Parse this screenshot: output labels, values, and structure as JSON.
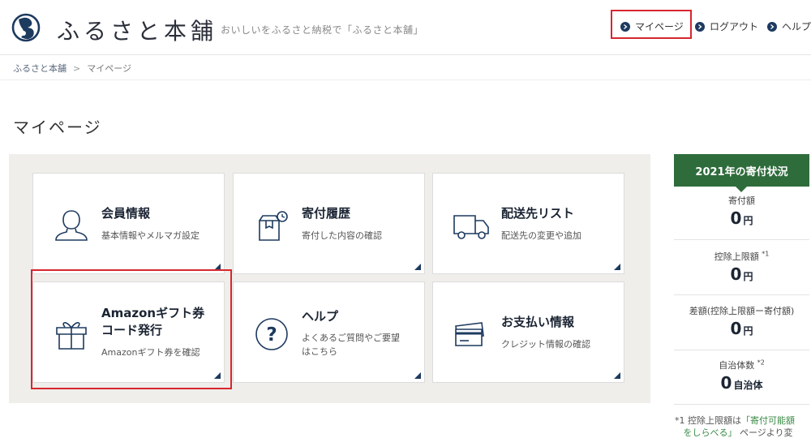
{
  "header": {
    "logo_text": "ふるさと本舗",
    "tagline": "おいしいをふるさと納税で「ふるさと本舗」",
    "nav": {
      "mypage": "マイページ",
      "logout": "ログアウト",
      "help": "ヘルプ"
    }
  },
  "breadcrumb": {
    "home": "ふるさと本舗",
    "separator": ">",
    "current": "マイページ"
  },
  "page_title": "マイページ",
  "menu": {
    "member": {
      "title": "会員情報",
      "desc": "基本情報やメルマガ設定"
    },
    "history": {
      "title": "寄付履歴",
      "desc": "寄付した内容の確認"
    },
    "delivery": {
      "title": "配送先リスト",
      "desc": "配送先の変更や追加"
    },
    "amazon": {
      "title_line1": "Amazonギフト券",
      "title_line2": "コード発行",
      "desc": "Amazonギフト券を確認"
    },
    "help": {
      "title": "ヘルプ",
      "desc_line1": "よくあるご質問やご要望",
      "desc_line2": "はこちら"
    },
    "payment": {
      "title": "お支払い情報",
      "desc": "クレジット情報の確認"
    }
  },
  "sidebar": {
    "title": "2021年の寄付状況",
    "donation": {
      "label": "寄付額",
      "value": "0",
      "unit": "円"
    },
    "limit": {
      "label": "控除上限額",
      "mark": "*1",
      "value": "0",
      "unit": "円"
    },
    "diff": {
      "label": "差額(控除上限額ー寄付額)",
      "value": "0",
      "unit": "円"
    },
    "municipalities": {
      "label": "自治体数",
      "mark": "*2",
      "value": "0",
      "unit": "自治体"
    }
  },
  "footnote": {
    "mark": "*1",
    "text1": "控除上限額は",
    "link_line1": "「寄付可能額",
    "link_line2": "をしらべる」",
    "text2": "ページより変"
  },
  "colors": {
    "navy": "#1d3a5f",
    "green": "#2f6c3c",
    "highlight_red": "#d8262f",
    "panel_bg": "#efeeea"
  }
}
